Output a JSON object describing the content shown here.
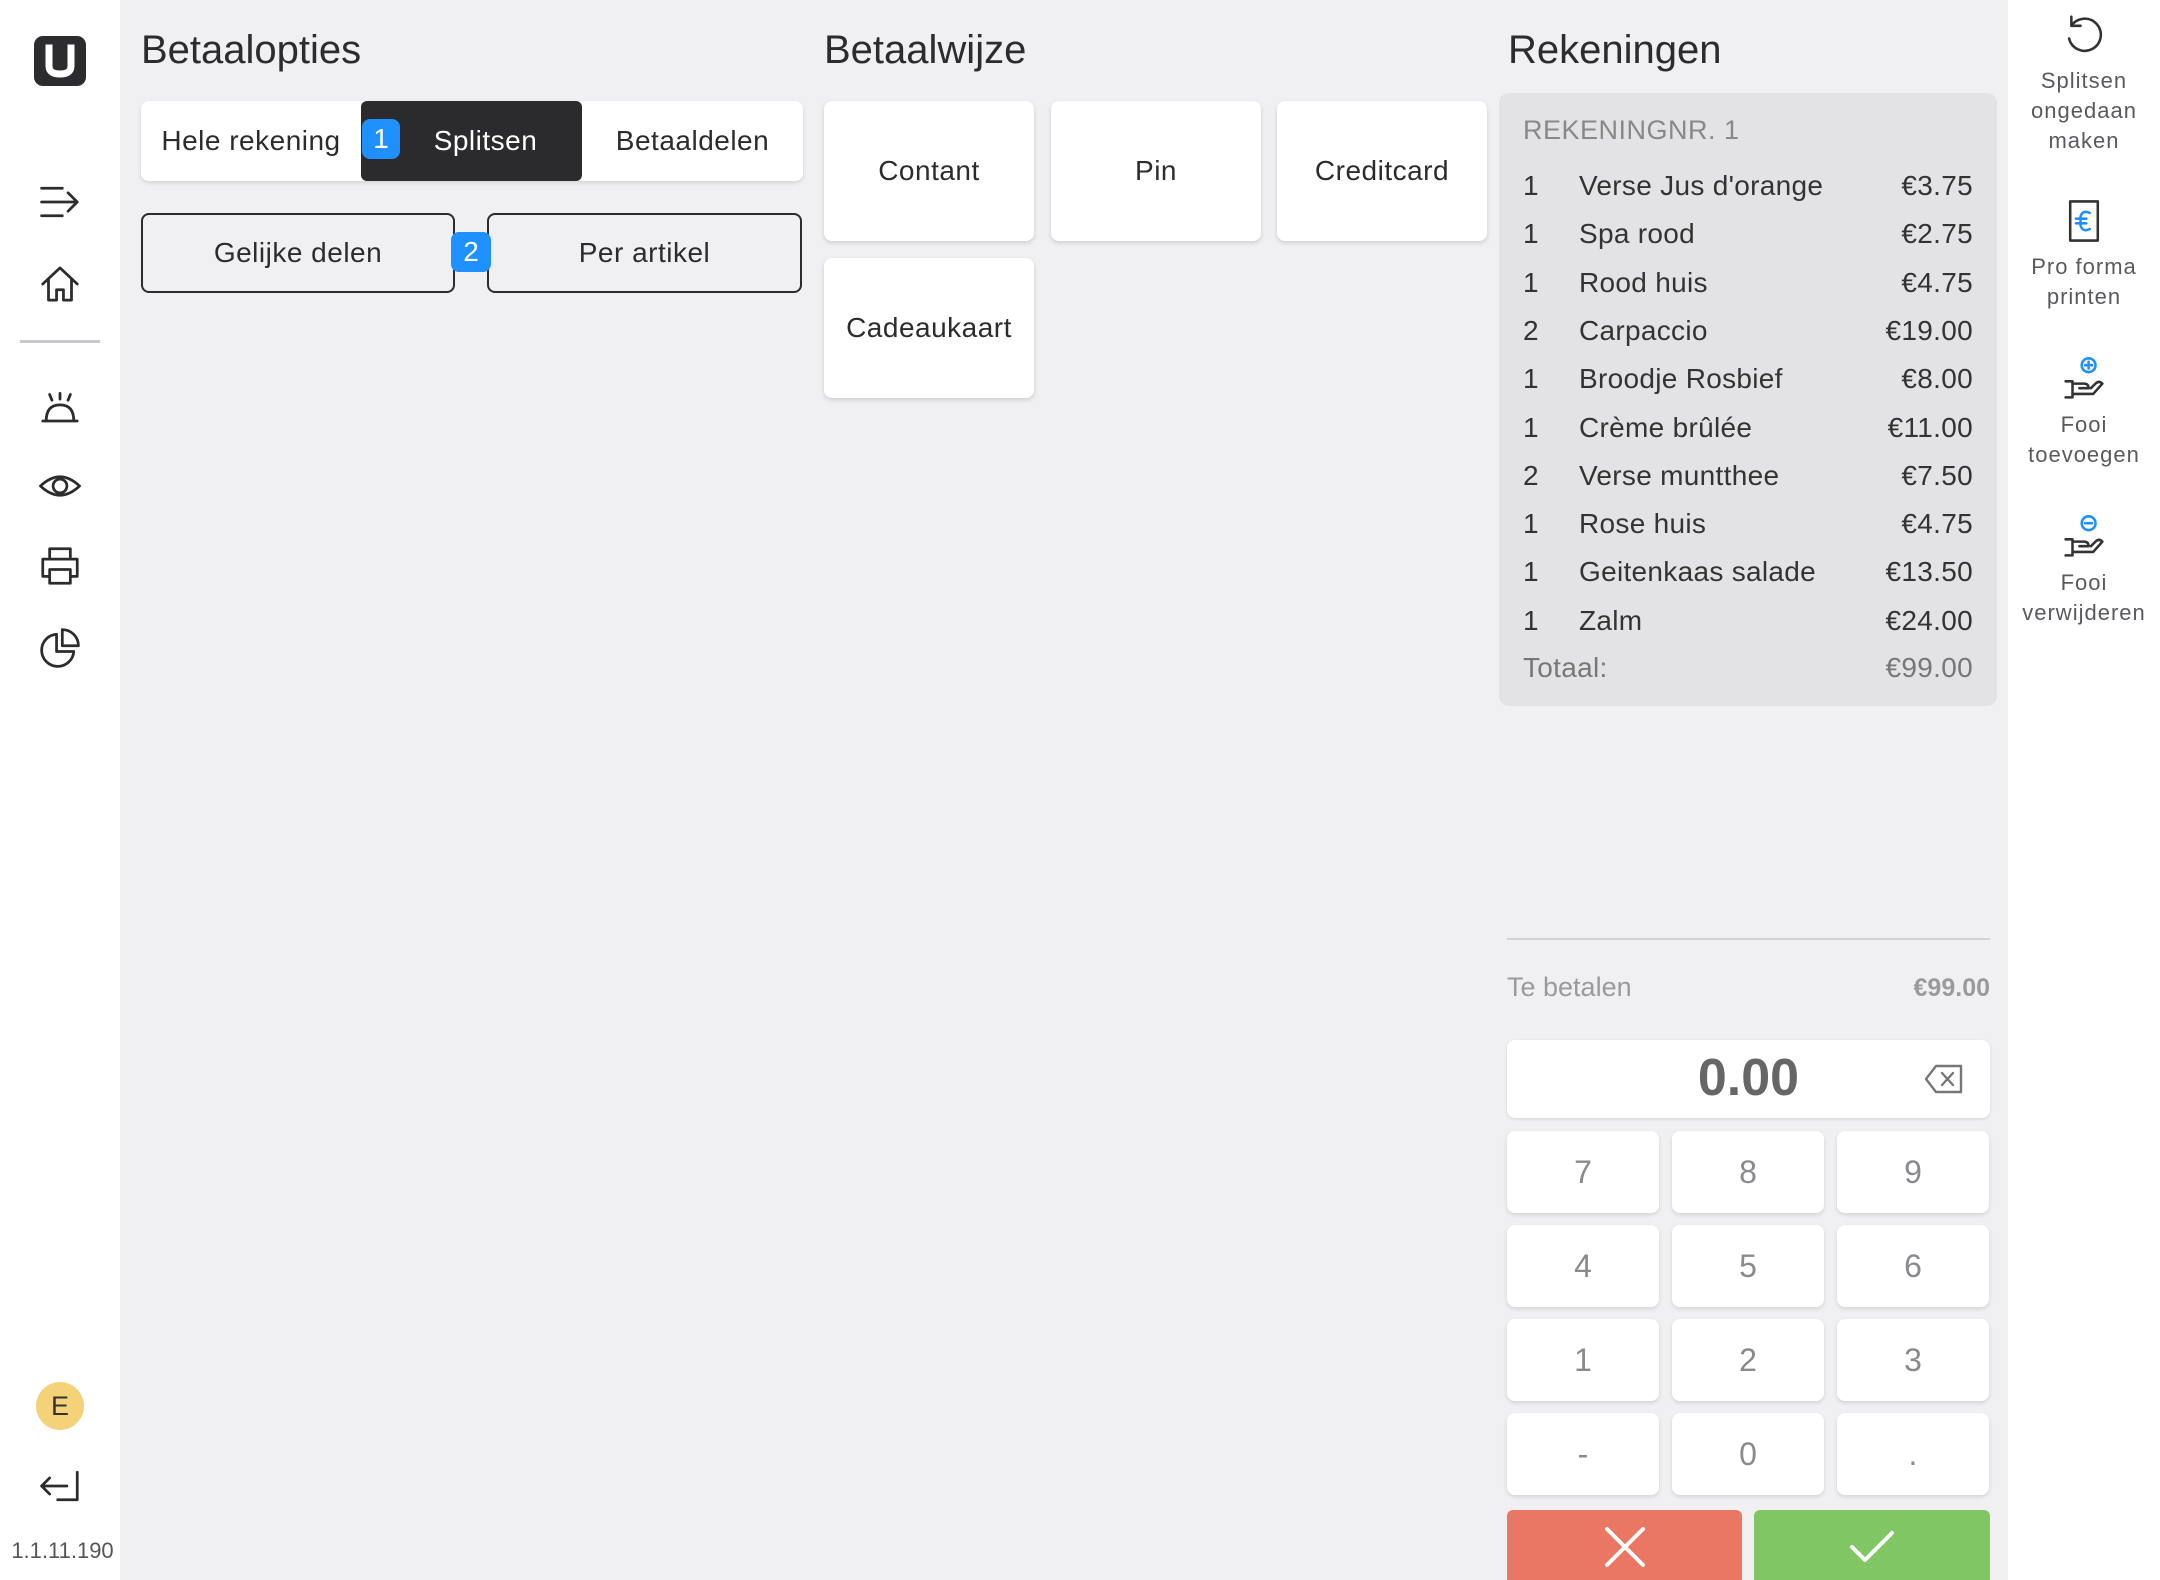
{
  "nav": {
    "logo_icon": "u-logo-icon",
    "items": [
      {
        "name": "menu-collapse-icon"
      },
      {
        "name": "home-icon"
      },
      {
        "name": "service-bell-icon"
      },
      {
        "name": "eye-icon"
      },
      {
        "name": "printer-icon"
      },
      {
        "name": "pie-chart-icon"
      }
    ],
    "user_initial": "E",
    "logout_icon": "logout-icon",
    "version": "1.1.11.190"
  },
  "payment_options": {
    "title": "Betaalopties",
    "segments": [
      {
        "label": "Hele rekening",
        "active": false
      },
      {
        "label": "Splitsen",
        "active": true
      },
      {
        "label": "Betaaldelen",
        "active": false
      }
    ],
    "step_badge_1": "1",
    "step_badge_2": "2",
    "split_buttons": [
      "Gelijke delen",
      "Per artikel"
    ]
  },
  "payment_method": {
    "title": "Betaalwijze",
    "methods": [
      "Contant",
      "Pin",
      "Creditcard",
      "Cadeaukaart"
    ]
  },
  "bills": {
    "title": "Rekeningen",
    "receipt_title": "REKENINGNR. 1",
    "items": [
      {
        "qty": "1",
        "name": "Verse Jus d'orange",
        "price": "€3.75"
      },
      {
        "qty": "1",
        "name": "Spa rood",
        "price": "€2.75"
      },
      {
        "qty": "1",
        "name": "Rood huis",
        "price": "€4.75"
      },
      {
        "qty": "2",
        "name": "Carpaccio",
        "price": "€19.00"
      },
      {
        "qty": "1",
        "name": "Broodje Rosbief",
        "price": "€8.00"
      },
      {
        "qty": "1",
        "name": "Crème brûlée",
        "price": "€11.00"
      },
      {
        "qty": "2",
        "name": "Verse muntthee",
        "price": "€7.50"
      },
      {
        "qty": "1",
        "name": "Rose huis",
        "price": "€4.75"
      },
      {
        "qty": "1",
        "name": "Geitenkaas salade",
        "price": "€13.50"
      },
      {
        "qty": "1",
        "name": "Zalm",
        "price": "€24.00"
      }
    ],
    "total_label": "Totaal:",
    "total_value": "€99.00"
  },
  "amount": {
    "to_pay_label": "Te betalen",
    "to_pay_value": "€99.00",
    "display_value": "0.00"
  },
  "keypad": {
    "keys": [
      "7",
      "8",
      "9",
      "4",
      "5",
      "6",
      "1",
      "2",
      "3",
      "-",
      "0",
      "."
    ],
    "cancel_color": "#e97763",
    "confirm_color": "#80c663"
  },
  "actions": [
    {
      "label": "Splitsen\nongedaan\nmaken",
      "icon": "undo-icon"
    },
    {
      "label": "Pro forma\nprinten",
      "icon": "receipt-euro-icon"
    },
    {
      "label": "Fooi\ntoevoegen",
      "icon": "tip-add-icon"
    },
    {
      "label": "Fooi\nverwijderen",
      "icon": "tip-remove-icon"
    }
  ],
  "colors": {
    "accent": "#1e90ff",
    "dark": "#2b2b2e",
    "background": "#f0f0f2"
  }
}
